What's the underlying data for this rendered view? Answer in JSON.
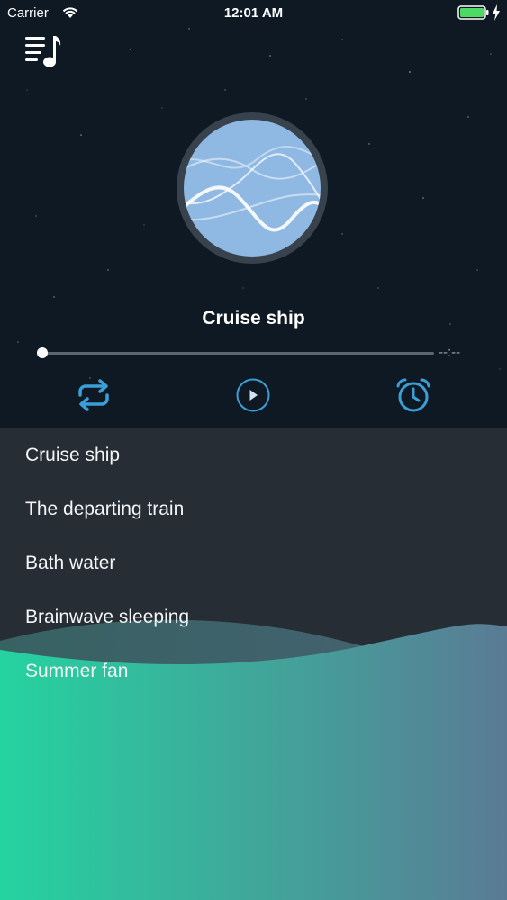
{
  "status_bar": {
    "carrier": "Carrier",
    "time": "12:01 AM"
  },
  "player": {
    "track_title": "Cruise ship",
    "progress": 0.0,
    "time_remaining": "--:--"
  },
  "icons": {
    "playlist": "music-list-icon",
    "repeat": "repeat-icon",
    "play": "play-circle-icon",
    "timer": "alarm-clock-icon"
  },
  "colors": {
    "background_top": "#0e1924",
    "list_background": "#262d35",
    "accent_blue": "#3a9fd6",
    "disc_fill": "#8fb8e2",
    "wave_green": "#25d3a0",
    "wave_slate": "#5a7b95"
  },
  "tracks": [
    {
      "label": "Cruise ship"
    },
    {
      "label": "The departing train"
    },
    {
      "label": "Bath water"
    },
    {
      "label": "Brainwave sleeping"
    },
    {
      "label": "Summer fan"
    }
  ]
}
